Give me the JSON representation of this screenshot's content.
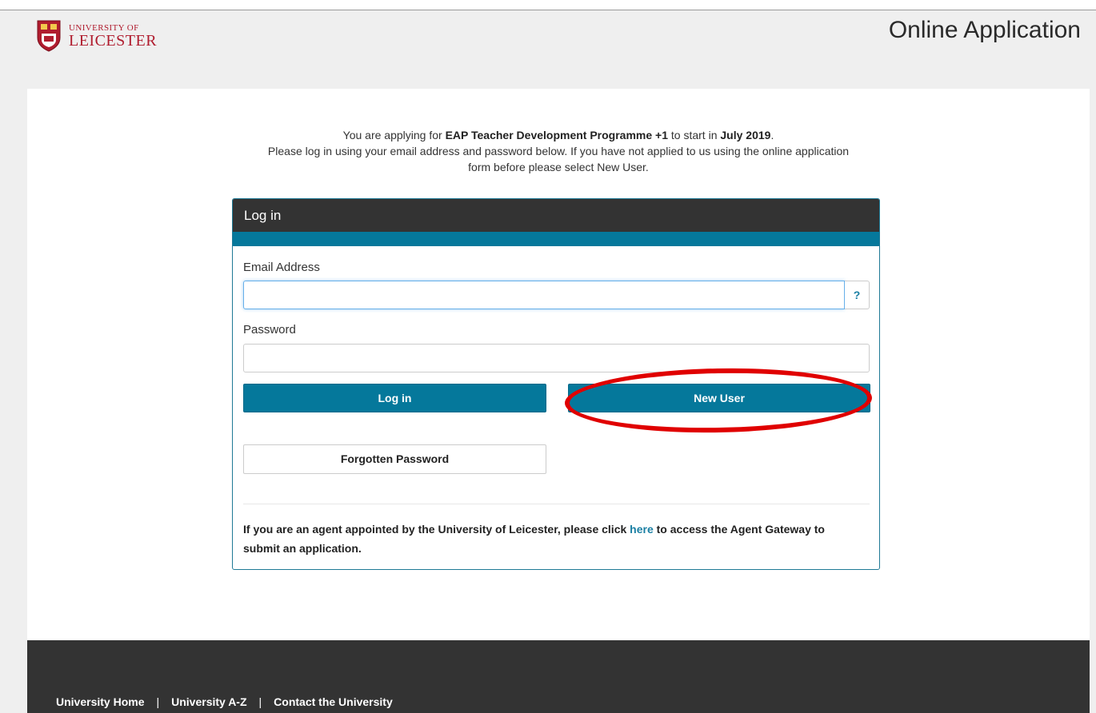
{
  "header": {
    "logo_line1": "UNIVERSITY OF",
    "logo_line2": "LEICESTER",
    "page_title": "Online Application"
  },
  "intro": {
    "prefix": "You are applying for ",
    "programme": "EAP Teacher Development Programme +1",
    "middle": " to start in ",
    "start_date": "July 2019",
    "suffix": ".",
    "line2": "Please log in using your email address and password below. If you have not applied to us using the online application",
    "line3": "form before please select New User."
  },
  "login": {
    "title": "Log in",
    "email_label": "Email Address",
    "email_value": "",
    "help_label": "?",
    "password_label": "Password",
    "password_value": "",
    "login_button": "Log in",
    "new_user_button": "New User",
    "forgotten_button": "Forgotten Password",
    "agent_prefix": "If you are an agent appointed by the University of Leicester, please click ",
    "agent_link": "here",
    "agent_suffix": " to access the Agent Gateway to submit an application."
  },
  "footer": {
    "links": [
      "University Home",
      "University A-Z",
      "Contact the University"
    ],
    "separator": "|"
  },
  "colors": {
    "brand_red": "#b01c2e",
    "accent_teal": "#05789b",
    "panel_dark": "#333333",
    "annotation_red": "#e00000"
  }
}
